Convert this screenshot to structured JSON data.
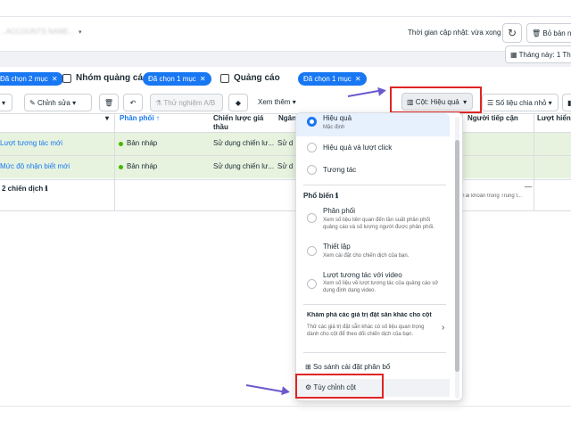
{
  "topbar": {
    "account_name": "...ACCOUNTS NAME...",
    "updated_text": "Thời gian cập nhật: vừa xong",
    "draft_label": "Bỏ bản nh",
    "date_label": "Tháng này: 1 Th"
  },
  "levels": {
    "campaign_chip": "Đã chọn 2 mục",
    "adset_label": "Nhóm quảng cáo",
    "adset_chip": "Đã chọn 1 mục",
    "ad_label": "Quảng cáo",
    "ad_chip": "Đã chọn 1 mục"
  },
  "toolbar": {
    "edit_label": "Chỉnh sửa",
    "abtest_label": "Thử nghiệm A/B",
    "more_label": "Xem thêm",
    "columns_label": "Cột: Hiệu quả",
    "breakdown_label": "Số liệu chia nhỏ"
  },
  "table": {
    "headers": {
      "delivery": "Phân phối ↑",
      "bid_strategy": "Chiến lược giá thầu",
      "budget": "Ngân",
      "reach": "Người tiếp cận",
      "results": "Lượt hiển t"
    },
    "rows": [
      {
        "name": "Lượt tương tác mới",
        "status": "Bản nháp",
        "bid": "Sử dụng chiến lư...",
        "budget": "Sử d"
      },
      {
        "name": "Mức độ nhận biết mới",
        "status": "Bản nháp",
        "bid": "Sử dụng chiến lư...",
        "budget": "Sử d"
      }
    ],
    "summary": "2 chiến dịch",
    "reach_dash": "—",
    "reach_note": "Tài khoản trong Trung t..."
  },
  "dropdown": {
    "options": [
      {
        "title": "Hiệu quả",
        "desc": "Mặc định",
        "selected": true
      },
      {
        "title": "Hiệu quả và lượt click",
        "desc": ""
      },
      {
        "title": "Tương tác",
        "desc": ""
      }
    ],
    "popular_title": "Phổ biến",
    "popular": [
      {
        "title": "Phân phối",
        "desc": "Xem số liệu liên quan đến tần suất phân phối quảng cáo và số lượng người được phân phối."
      },
      {
        "title": "Thiết lập",
        "desc": "Xem cài đặt cho chiến dịch của bạn."
      },
      {
        "title": "Lượt tương tác với video",
        "desc": "Xem số liệu về lượt tương tác của quảng cáo sử dụng định dạng video."
      }
    ],
    "explore_title": "Khám phá các giá trị đặt sẵn khác cho cột",
    "explore_desc": "Thử các giá trị đặt sẵn khác có số liệu quan trọng dành cho cột để theo dõi chiến dịch của bạn.",
    "compare_label": "So sánh cài đặt phân bổ",
    "customize_label": "Tùy chỉnh cột"
  },
  "colors": {
    "accent": "#1877f2",
    "highlight_box": "#e02424",
    "arrow": "#6a5acd",
    "row_bg": "#e7f3df"
  }
}
